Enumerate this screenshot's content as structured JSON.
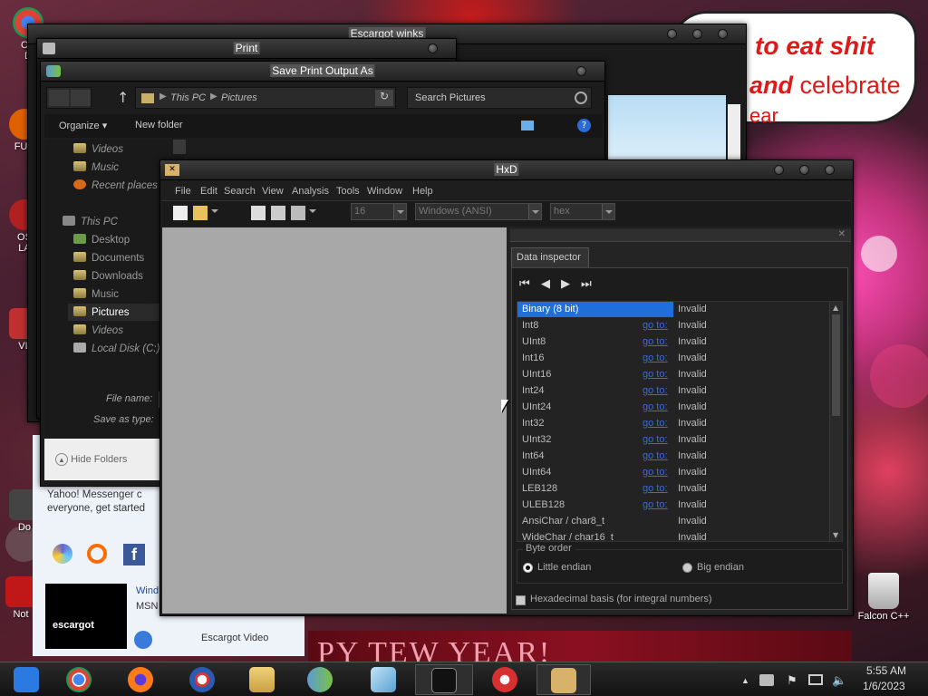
{
  "desktop": {
    "icons": [
      {
        "label": "CH\nD",
        "color": "#db4437"
      },
      {
        "label": "FUR",
        "color": "#e06000"
      },
      {
        "label": "OS\nLA",
        "color": "#b02020"
      },
      {
        "label": "VL",
        "color": "#c03030"
      },
      {
        "label": "Do",
        "color": "#444"
      },
      {
        "label": "Not",
        "color": "#c01818"
      }
    ],
    "bubble": {
      "line1": "to eat shit",
      "line2_bold": "and",
      "line2_rest": " celebrate",
      "line3": "ear"
    },
    "recycle_bin_label": "Falcon C++",
    "banner_text": "PY TEW YEAR!",
    "escargot_winks_title": "Escargot winks",
    "messenger_text_1": "Yahoo! Messenger c",
    "messenger_text_2": "everyone, get started",
    "messenger_link_1": "Wind",
    "messenger_link_2": "MSN",
    "escargot_video": "Escargot Video",
    "escargot_logo_text": "escargot"
  },
  "print_window": {
    "title": "Print"
  },
  "save_dialog": {
    "title": "Save Print Output As",
    "breadcrumb": [
      "This PC",
      "Pictures"
    ],
    "search_placeholder": "Search Pictures",
    "organize_label": "Organize",
    "new_folder_label": "New folder",
    "sidebar": [
      {
        "label": "Videos"
      },
      {
        "label": "Music"
      },
      {
        "label": "Recent places"
      },
      {
        "label": "This PC"
      },
      {
        "label": "Desktop"
      },
      {
        "label": "Documents"
      },
      {
        "label": "Downloads"
      },
      {
        "label": "Music"
      },
      {
        "label": "Pictures"
      },
      {
        "label": "Videos"
      },
      {
        "label": "Local Disk (C:)"
      }
    ],
    "file_name_label": "File name:",
    "save_type_label": "Save as type:",
    "hide_folders_label": "Hide Folders"
  },
  "hxd": {
    "title": "HxD",
    "menu": [
      "File",
      "Edit",
      "Search",
      "View",
      "Analysis",
      "Tools",
      "Window",
      "Help"
    ],
    "bytes_per_row": "16",
    "charset": "Windows (ANSI)",
    "offset_base": "hex",
    "data_inspector": {
      "tab_label": "Data inspector",
      "rows": [
        {
          "name": "Binary (8 bit)",
          "goto": "",
          "value": "Invalid",
          "selected": true
        },
        {
          "name": "Int8",
          "goto": "go to:",
          "value": "Invalid"
        },
        {
          "name": "UInt8",
          "goto": "go to:",
          "value": "Invalid"
        },
        {
          "name": "Int16",
          "goto": "go to:",
          "value": "Invalid"
        },
        {
          "name": "UInt16",
          "goto": "go to:",
          "value": "Invalid"
        },
        {
          "name": "Int24",
          "goto": "go to:",
          "value": "Invalid"
        },
        {
          "name": "UInt24",
          "goto": "go to:",
          "value": "Invalid"
        },
        {
          "name": "Int32",
          "goto": "go to:",
          "value": "Invalid"
        },
        {
          "name": "UInt32",
          "goto": "go to:",
          "value": "Invalid"
        },
        {
          "name": "Int64",
          "goto": "go to:",
          "value": "Invalid"
        },
        {
          "name": "UInt64",
          "goto": "go to:",
          "value": "Invalid"
        },
        {
          "name": "LEB128",
          "goto": "go to:",
          "value": "Invalid"
        },
        {
          "name": "ULEB128",
          "goto": "go to:",
          "value": "Invalid"
        },
        {
          "name": "AnsiChar / char8_t",
          "goto": "",
          "value": "Invalid"
        },
        {
          "name": "WideChar / char16_t",
          "goto": "",
          "value": "Invalid"
        }
      ],
      "byte_order_label": "Byte order",
      "little_endian_label": "Little endian",
      "big_endian_label": "Big endian",
      "selected_byte_order": "Little endian",
      "hex_basis_label": "Hexadecimal basis (for integral numbers)",
      "hex_basis_checked": false
    }
  },
  "taskbar": {
    "apps": [
      {
        "name": "ie-icon",
        "color": "#2a7ae2"
      },
      {
        "name": "chrome-icon",
        "color": "#db4437"
      },
      {
        "name": "firefox-icon",
        "color": "#ff7a18"
      },
      {
        "name": "obama-icon",
        "color": "#2a5bb0"
      },
      {
        "name": "file-explorer-icon",
        "color": "#e8c35a"
      },
      {
        "name": "people-icon",
        "color": "#4a9a3a"
      },
      {
        "name": "notepad-icon",
        "color": "#6ab0d8"
      },
      {
        "name": "cmd-icon",
        "color": "#111111"
      },
      {
        "name": "pinball-icon",
        "color": "#d83030"
      },
      {
        "name": "hxd-icon",
        "color": "#d8b26a"
      }
    ],
    "time": "5:55 AM",
    "date": "1/6/2023"
  }
}
